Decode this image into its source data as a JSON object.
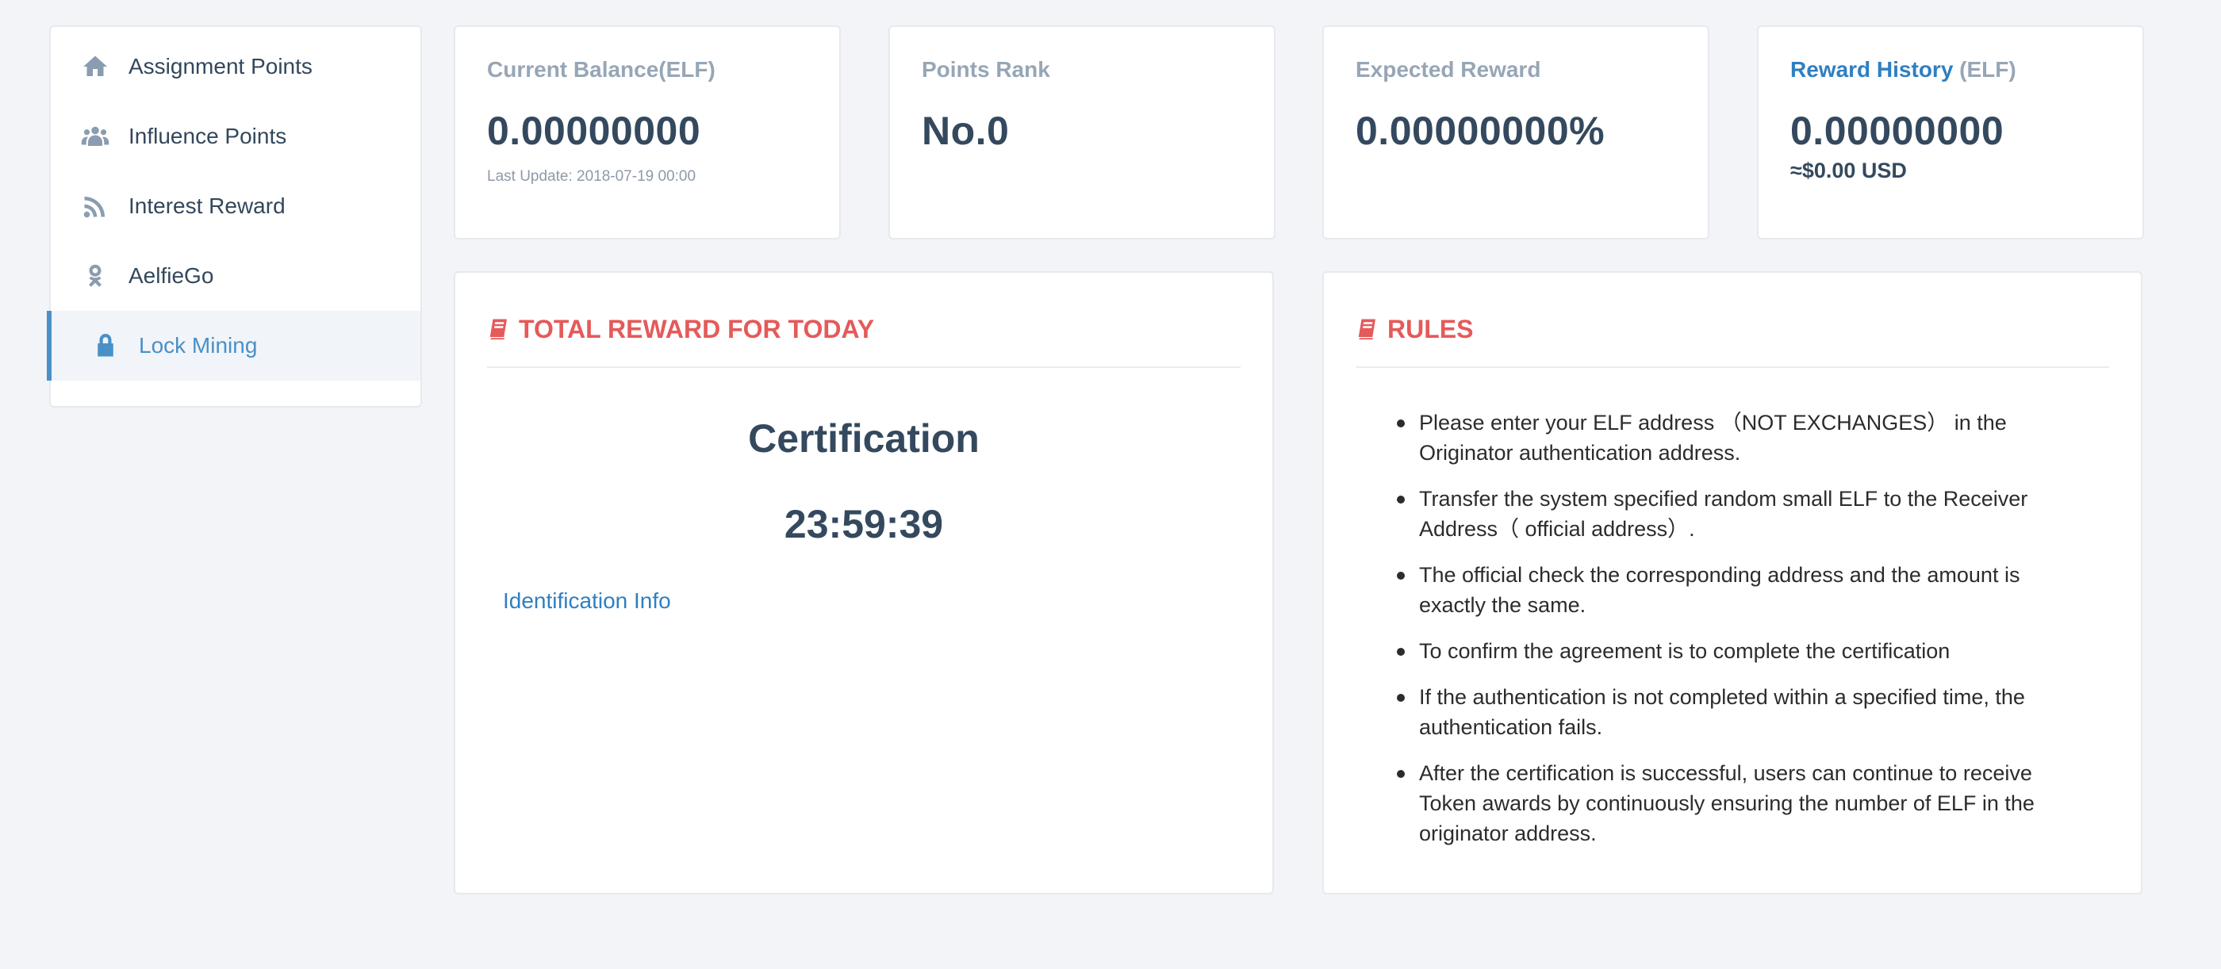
{
  "sidebar": {
    "items": [
      {
        "label": "Assignment Points",
        "icon": "home-icon",
        "active": false
      },
      {
        "label": "Influence Points",
        "icon": "users-icon",
        "active": false
      },
      {
        "label": "Interest Reward",
        "icon": "rss-icon",
        "active": false
      },
      {
        "label": "AelfieGo",
        "icon": "odnoklassniki-icon",
        "active": false
      },
      {
        "label": "Lock Mining",
        "icon": "lock-icon",
        "active": true
      }
    ]
  },
  "stats": {
    "balance": {
      "label": "Current Balance(ELF)",
      "value": "0.00000000",
      "sub": "Last Update: 2018-07-19 00:00"
    },
    "rank": {
      "label": "Points Rank",
      "value": "No.0"
    },
    "expected": {
      "label": "Expected Reward",
      "value": "0.00000000%"
    },
    "history": {
      "label_link": "Reward History",
      "label_unit": " (ELF)",
      "value": "0.00000000",
      "usd": "≈$0.00 USD"
    }
  },
  "reward_panel": {
    "title": "TOTAL REWARD FOR TODAY",
    "cert_title": "Certification",
    "timer": "23:59:39",
    "ident_link": "Identification Info"
  },
  "rules_panel": {
    "title": "RULES",
    "rules": [
      "Please enter your ELF address （NOT EXCHANGES） in the Originator authentication address.",
      "Transfer the system specified random small ELF to the Receiver Address（ official address）.",
      "The official check the corresponding address and the amount is exactly the same.",
      "To confirm the agreement is to complete the certification",
      "If the authentication is not completed within a specified time, the authentication fails.",
      "After the certification is successful, users can continue to receive Token awards by continuously ensuring the number of ELF in the originator address."
    ]
  },
  "colors": {
    "accent": "#4a90c8",
    "link": "#2f7fc1",
    "danger": "#e55a5a",
    "text": "#34495e",
    "muted": "#96a6b6"
  }
}
